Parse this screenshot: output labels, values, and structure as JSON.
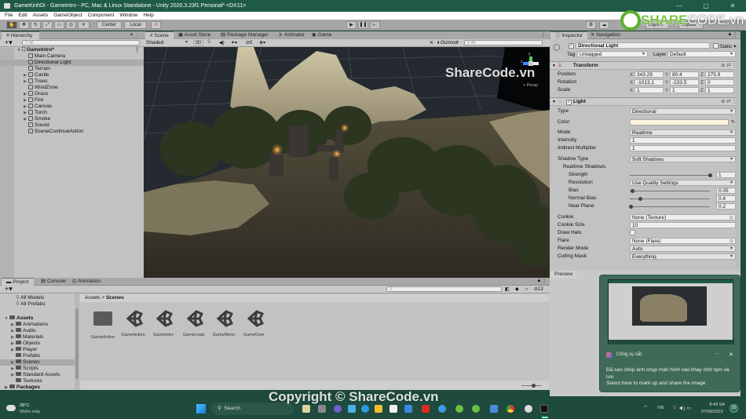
{
  "window": {
    "title": "GameKinhDi - GameIntro - PC, Mac & Linux Standalone - Unity 2020.3.23f1 Personal* <DX11>",
    "controls": [
      "—",
      "▢",
      "✕"
    ]
  },
  "menu": [
    "File",
    "Edit",
    "Assets",
    "GameObject",
    "Component",
    "Window",
    "Help"
  ],
  "toolbar": {
    "pivot_label": "Center",
    "space_label": "Local",
    "layers_label": "Layers",
    "layout_label": "Layout"
  },
  "hierarchy": {
    "tab_label": "Hierarchy",
    "search_placeholder": "All",
    "scene_name": "GameIntro*",
    "items": [
      {
        "label": "Main Camera",
        "expandable": false,
        "selected": false
      },
      {
        "label": "Directional Light",
        "expandable": false,
        "selected": true
      },
      {
        "label": "Terrain",
        "expandable": false,
        "selected": false
      },
      {
        "label": "Castle",
        "expandable": true,
        "selected": false
      },
      {
        "label": "Trees",
        "expandable": true,
        "selected": false
      },
      {
        "label": "WindZone",
        "expandable": false,
        "selected": false
      },
      {
        "label": "Grass",
        "expandable": true,
        "selected": false
      },
      {
        "label": "Fire",
        "expandable": true,
        "selected": false
      },
      {
        "label": "Canvas",
        "expandable": true,
        "selected": false
      },
      {
        "label": "Torch",
        "expandable": true,
        "selected": false
      },
      {
        "label": "Smoke",
        "expandable": true,
        "selected": false
      },
      {
        "label": "Sound",
        "expandable": false,
        "selected": false
      },
      {
        "label": "SceneContinueAction",
        "expandable": false,
        "selected": false
      }
    ]
  },
  "scene_tabs": [
    "Scene",
    "Asset Store",
    "Package Manager",
    "Animator",
    "Game"
  ],
  "scene_toolbar": {
    "shading": "Shaded",
    "mode_2d": "2D",
    "hidden_count": "0",
    "gizmos": "Gizmos",
    "search_placeholder": "All"
  },
  "scene_gizmo": {
    "y": "y",
    "x": "x",
    "z": "z",
    "persp": "< Persp"
  },
  "inspector": {
    "tabs": [
      "Inspector",
      "Navigation"
    ],
    "object_name": "Directional Light",
    "static_label": "Static",
    "tag_label": "Tag",
    "tag_value": "Untagged",
    "layer_label": "Layer",
    "layer_value": "Default",
    "transform": {
      "title": "Transform",
      "position_label": "Position",
      "position": {
        "x": "343.29",
        "y": "80.4",
        "z": "275.9"
      },
      "rotation_label": "Rotation",
      "rotation": {
        "x": "-1013.1",
        "y": "-233.5",
        "z": "0"
      },
      "scale_label": "Scale",
      "scale": {
        "x": "1",
        "y": "1",
        "z": "1"
      }
    },
    "light": {
      "title": "Light",
      "color_hex": "#fdf4dc",
      "fields": {
        "type_label": "Type",
        "type": "Directional",
        "color_label": "Color",
        "mode_label": "Mode",
        "mode": "Realtime",
        "intensity_label": "Intensity",
        "intensity": "1",
        "indirect_label": "Indirect Multiplier",
        "indirect": "1",
        "shadow_type_label": "Shadow Type",
        "shadow_type": "Soft Shadows",
        "realtime_shadows_label": "Realtime Shadows",
        "strength_label": "Strength",
        "strength": "1",
        "strength_fraction": 1.0,
        "resolution_label": "Resolution",
        "resolution": "Use Quality Settings",
        "bias_label": "Bias",
        "bias": "0.05",
        "bias_fraction": 0.025,
        "normal_bias_label": "Normal Bias",
        "normal_bias": "0.4",
        "normal_bias_fraction": 0.13,
        "near_plane_label": "Near Plane",
        "near_plane": "0.2",
        "near_plane_fraction": 0.01,
        "cookie_label": "Cookie",
        "cookie": "None (Texture)",
        "cookie_size_label": "Cookie Size",
        "cookie_size": "10",
        "draw_halo_label": "Draw Halo",
        "flare_label": "Flare",
        "flare": "None (Flare)",
        "render_mode_label": "Render Mode",
        "render_mode": "Auto",
        "culling_mask_label": "Culling Mask",
        "culling_mask": "Everything"
      }
    },
    "preview_label": "Preview"
  },
  "project": {
    "tabs": [
      "Project",
      "Console",
      "Animation"
    ],
    "favorites": [
      "All Models",
      "All Prefabs"
    ],
    "tree": [
      {
        "label": "Assets",
        "level": 0,
        "bold": true,
        "expandable": true,
        "selected": false
      },
      {
        "label": "Animations",
        "level": 1,
        "expandable": true,
        "selected": false
      },
      {
        "label": "Audio",
        "level": 1,
        "expandable": true,
        "selected": false
      },
      {
        "label": "Materials",
        "level": 1,
        "expandable": true,
        "selected": false
      },
      {
        "label": "Objects",
        "level": 1,
        "expandable": true,
        "selected": false
      },
      {
        "label": "Player",
        "level": 1,
        "expandable": true,
        "selected": false
      },
      {
        "label": "Prefabs",
        "level": 1,
        "expandable": false,
        "selected": false
      },
      {
        "label": "Scenes",
        "level": 1,
        "expandable": true,
        "selected": true
      },
      {
        "label": "Scripts",
        "level": 1,
        "expandable": true,
        "selected": false
      },
      {
        "label": "Standard Assets",
        "level": 1,
        "expandable": true,
        "selected": false
      },
      {
        "label": "Textures",
        "level": 1,
        "expandable": false,
        "selected": false
      },
      {
        "label": "Packages",
        "level": 0,
        "bold": true,
        "expandable": true,
        "selected": false
      }
    ],
    "breadcrumb": [
      "Assets",
      "Scenes"
    ],
    "hidden_count": "13",
    "assets": [
      {
        "name": "GameAction",
        "kind": "folder"
      },
      {
        "name": "GameAction",
        "kind": "scene"
      },
      {
        "name": "GameIntro",
        "kind": "scene"
      },
      {
        "name": "GameLoad",
        "kind": "scene"
      },
      {
        "name": "GameMenu",
        "kind": "scene"
      },
      {
        "name": "GameOver",
        "kind": "scene"
      }
    ]
  },
  "toast": {
    "app_name": "Công cụ cắt",
    "more": "···",
    "close": "✕",
    "message": "Đã sao chép ảnh chụp màn hình vào khay nhớ tạm và lưu",
    "action": "Select here to mark up and share the image"
  },
  "taskbar": {
    "weather_temp": "28°C",
    "weather_desc": "Nhiều mây",
    "search_label": "Search",
    "language": "VIE",
    "time": "8:49 SA",
    "date": "07/06/2023",
    "notification_count": "20"
  },
  "watermark": {
    "logo_text_bold": "SHARE",
    "logo_text": "CODE.vn",
    "scene_text": "ShareCode.vn",
    "copyright": "Copyright © ShareCode.vn"
  }
}
